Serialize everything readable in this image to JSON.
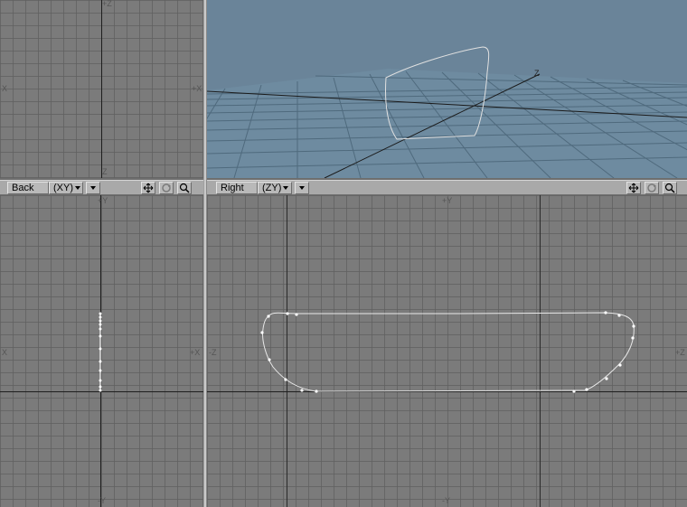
{
  "viewports": {
    "top_left": {
      "labels": {
        "top": "+Z",
        "left": "X",
        "right": "+X",
        "bottom": "Z"
      }
    },
    "back": {
      "name": "Back",
      "axes_mode": "(XY)",
      "labels": {
        "top": "+Y",
        "left": "X",
        "right": "+X",
        "bottom": "-Y"
      }
    },
    "right": {
      "name": "Right",
      "axes_mode": "(ZY)",
      "labels": {
        "top": "+Y",
        "left": "-Z",
        "right": "+Z",
        "bottom": "-Y"
      }
    },
    "perspective": {
      "labels": {
        "axis": "Z"
      }
    }
  },
  "icons": {
    "move": "move-icon",
    "rotate": "rotate-icon",
    "zoom": "zoom-icon"
  },
  "colors": {
    "grid_bg": "#7b7b7b",
    "persp_bg": "#6a8499",
    "curve": "#e8e8e8",
    "toolbar": "#a9a9a9"
  }
}
